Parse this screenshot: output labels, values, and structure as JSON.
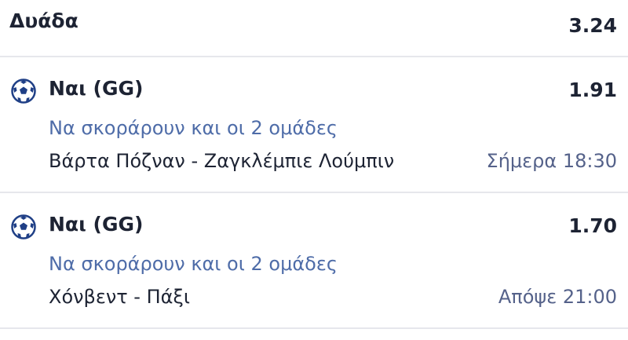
{
  "header": {
    "title": "Δυάδα",
    "odds": "3.24"
  },
  "selections": [
    {
      "icon": "soccer-ball-icon",
      "pick": "Ναι (GG)",
      "odds": "1.91",
      "market": "Να σκοράρουν και οι 2 ομάδες",
      "match": "Βάρτα Πόζναν - Ζαγκλέμπιε Λούμπιν",
      "time": "Σήμερα 18:30"
    },
    {
      "icon": "soccer-ball-icon",
      "pick": "Ναι (GG)",
      "odds": "1.70",
      "market": "Να σκοράρουν και οι 2 ομάδες",
      "match": "Χόνβεντ - Πάξι",
      "time": "Απόψε 21:00"
    }
  ],
  "colors": {
    "primary_text": "#1d2333",
    "market_text": "#4e6ca8",
    "time_text": "#55628a",
    "divider": "#e6e7ec",
    "ball_accent": "#1f3f86"
  }
}
